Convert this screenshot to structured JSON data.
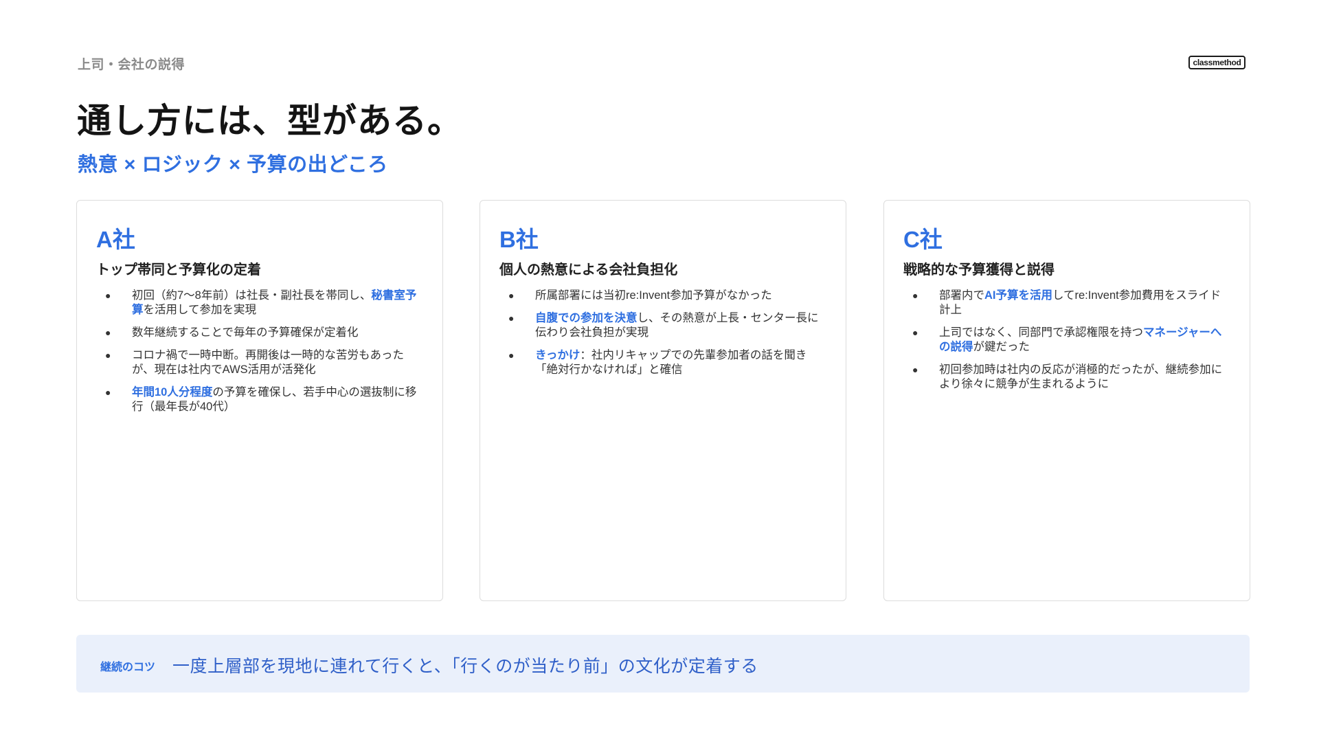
{
  "header": {
    "eyebrow": "上司・会社の説得",
    "logo": "classmethod",
    "title": "通し方には、型がある。",
    "subtitle": "熱意 × ロジック × 予算の出どころ"
  },
  "cards": [
    {
      "name": "A社",
      "heading": "トップ帯同と予算化の定着",
      "bullets": [
        {
          "pre": "初回（約7〜8年前）は社長・副社長を帯同し、",
          "hl": "秘書室予算",
          "post": "を活用して参加を実現"
        },
        {
          "pre": "数年継続することで毎年の予算確保が定着化",
          "hl": "",
          "post": ""
        },
        {
          "pre": "コロナ禍で一時中断。再開後は一時的な苦労もあったが、現在は社内でAWS活用が活発化",
          "hl": "",
          "post": ""
        },
        {
          "pre": "",
          "hl": "年間10人分程度",
          "post": "の予算を確保し、若手中心の選抜制に移行（最年長が40代）"
        }
      ]
    },
    {
      "name": "B社",
      "heading": "個人の熱意による会社負担化",
      "bullets": [
        {
          "pre": "所属部署には当初re:Invent参加予算がなかった",
          "hl": "",
          "post": ""
        },
        {
          "pre": "",
          "hl": "自腹での参加を決意",
          "post": "し、その熱意が上長・センター長に伝わり会社負担が実現"
        },
        {
          "pre": "",
          "hl": "きっかけ",
          "post": "：社内リキャップでの先輩参加者の話を聞き「絶対行かなければ」と確信"
        }
      ]
    },
    {
      "name": "C社",
      "heading": "戦略的な予算獲得と説得",
      "bullets": [
        {
          "pre": "部署内で",
          "hl": "AI予算を活用",
          "post": "してre:Invent参加費用をスライド計上"
        },
        {
          "pre": "上司ではなく、同部門で承認権限を持つ",
          "hl": "マネージャーへの説得",
          "post": "が鍵だった"
        },
        {
          "pre": "初回参加時は社内の反応が消極的だったが、継続参加により徐々に競争が生まれるように",
          "hl": "",
          "post": ""
        }
      ]
    }
  ],
  "tip": {
    "label": "継続のコツ",
    "text": "一度上層部を現地に連れて行くと、「行くのが当たり前」の文化が定着する"
  }
}
